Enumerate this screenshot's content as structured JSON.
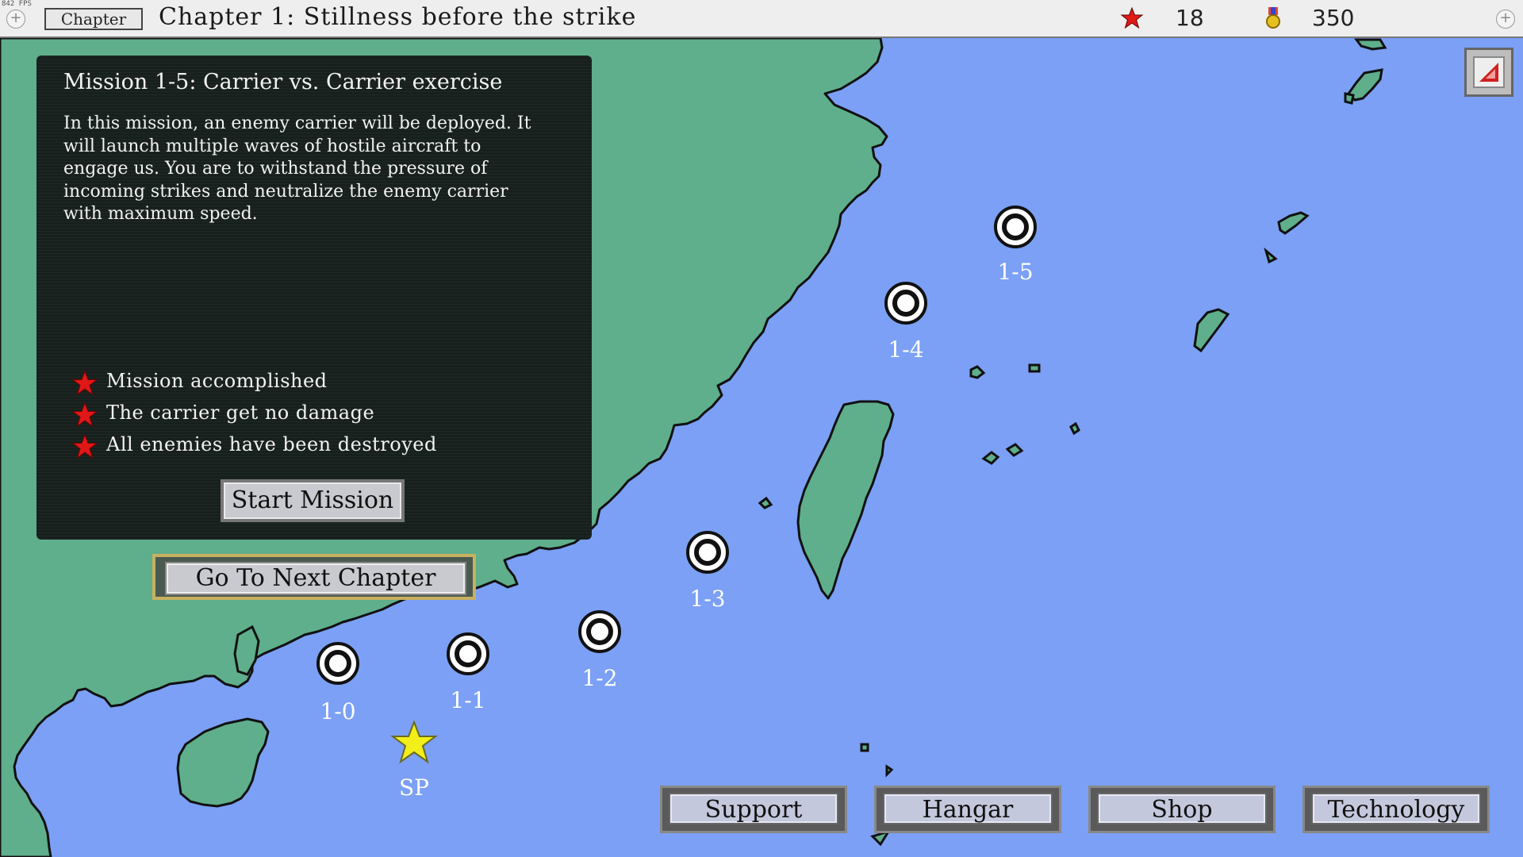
{
  "top_bar": {
    "fps_label": "842 FPS",
    "chapter_button": "Chapter",
    "chapter_title": "Chapter 1: Stillness before the strike",
    "stars_count": "18",
    "medals_count": "350"
  },
  "mission_panel": {
    "title": "Mission 1-5: Carrier vs. Carrier exercise",
    "description": "In this mission, an enemy carrier will be deployed. It will launch multiple waves of hostile aircraft to engage us. You are to withstand the pressure of incoming strikes and neutralize the enemy carrier with maximum speed.",
    "objectives": [
      "Mission accomplished",
      "The carrier get no damage",
      "All enemies have been destroyed"
    ],
    "start_button": "Start Mission"
  },
  "next_chapter_button": "Go To Next Chapter",
  "map_markers": [
    {
      "label": "SP"
    },
    {
      "label": "1-0"
    },
    {
      "label": "1-1"
    },
    {
      "label": "1-2"
    },
    {
      "label": "1-3"
    },
    {
      "label": "1-4"
    },
    {
      "label": "1-5"
    }
  ],
  "bottom_buttons": [
    "Support",
    "Hangar",
    "Shop",
    "Technology"
  ],
  "colors": {
    "sea": "#7ba0f5",
    "land": "#5fae8c",
    "panel": "#17201d",
    "objective_star": "#e01818",
    "start_star": "#f2ee1a"
  },
  "icons": [
    "star-icon",
    "medal-icon",
    "plus-icon",
    "mission-node-icon",
    "corner-menu-icon"
  ]
}
